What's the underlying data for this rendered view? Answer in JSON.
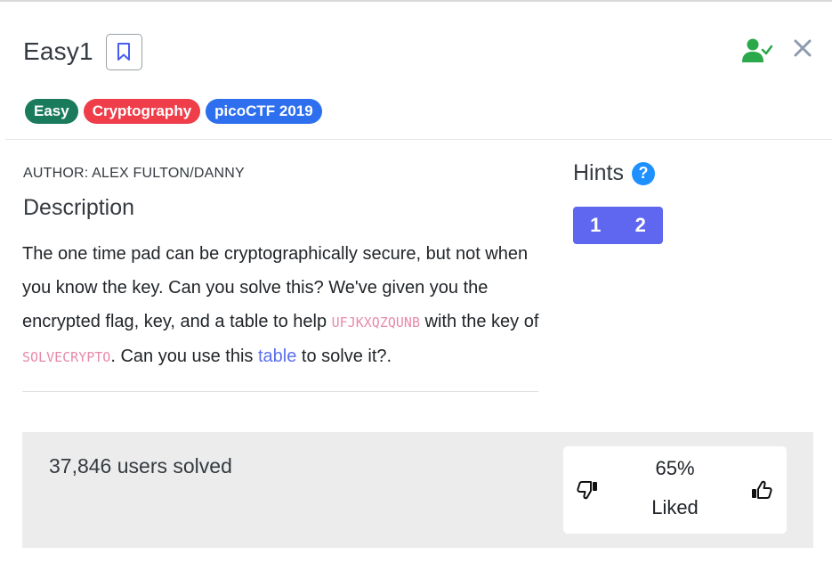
{
  "challenge": {
    "title": "Easy1",
    "tags": [
      {
        "label": "Easy",
        "color": "#1a7a5c"
      },
      {
        "label": "Cryptography",
        "color": "#ef3e4a"
      },
      {
        "label": "picoCTF 2019",
        "color": "#2d6fef"
      }
    ],
    "author": "AUTHOR: ALEX FULTON/DANNY",
    "description_heading": "Description",
    "description": {
      "part1": "The one time pad can be cryptographically secure, but not when you know the key. Can you solve this? We've given you the encrypted flag, key, and a table to help ",
      "encrypted_flag": "UFJKXQZQUNB",
      "part2": " with the key of ",
      "key": "SOLVECRYPTO",
      "part3": ". Can you use this ",
      "link_text": "table",
      "part4": " to solve it?."
    }
  },
  "hints": {
    "heading": "Hints",
    "help_icon_label": "?",
    "buttons": [
      "1",
      "2"
    ]
  },
  "stats": {
    "solved": "37,846 users solved",
    "percent": "65%",
    "liked_label": "Liked"
  },
  "icons": {
    "bookmark": "bookmark-icon",
    "user_check": "user-check-icon",
    "close": "close-icon",
    "thumbs_down": "thumbs-down-icon",
    "thumbs_up": "thumbs-up-icon"
  },
  "colors": {
    "accent": "#5f67f0",
    "success": "#2aa84a",
    "code": "#e88aaa"
  }
}
